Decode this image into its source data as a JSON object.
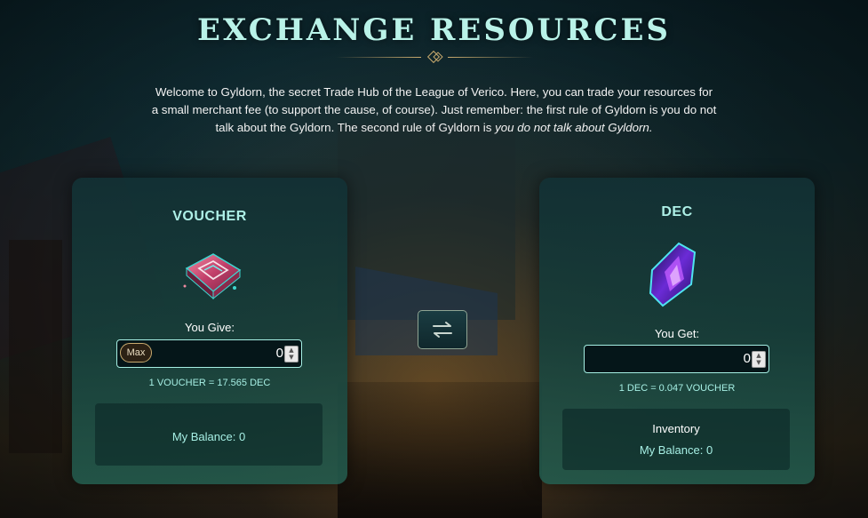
{
  "page": {
    "title": "EXCHANGE RESOURCES",
    "intro_text": "Welcome to Gyldorn, the secret Trade Hub of the League of Verico. Here, you can trade your resources for a small merchant fee (to support the cause, of course). Just remember: the first rule of Gyldorn is you do not talk about the Gyldorn. The second rule of Gyldorn is ",
    "intro_emphasis": "you do not talk about Gyldorn."
  },
  "give_card": {
    "title": "VOUCHER",
    "icon": "voucher-icon",
    "label": "You Give:",
    "max_label": "Max",
    "value": "0",
    "rate": "1 VOUCHER = 17.565 DEC",
    "balance": "My Balance: 0"
  },
  "swap": {
    "icon": "swap-arrows-icon"
  },
  "get_card": {
    "title": "DEC",
    "icon": "dec-crystal-icon",
    "label": "You Get:",
    "value": "0",
    "rate": "1 DEC = 0.047 VOUCHER",
    "inventory_label": "Inventory",
    "balance": "My Balance: 0"
  },
  "colors": {
    "title": "#b9f2e8",
    "accent_teal": "#a6efe4",
    "gold": "#c9aa6e",
    "card_bg": "#163e3a"
  }
}
